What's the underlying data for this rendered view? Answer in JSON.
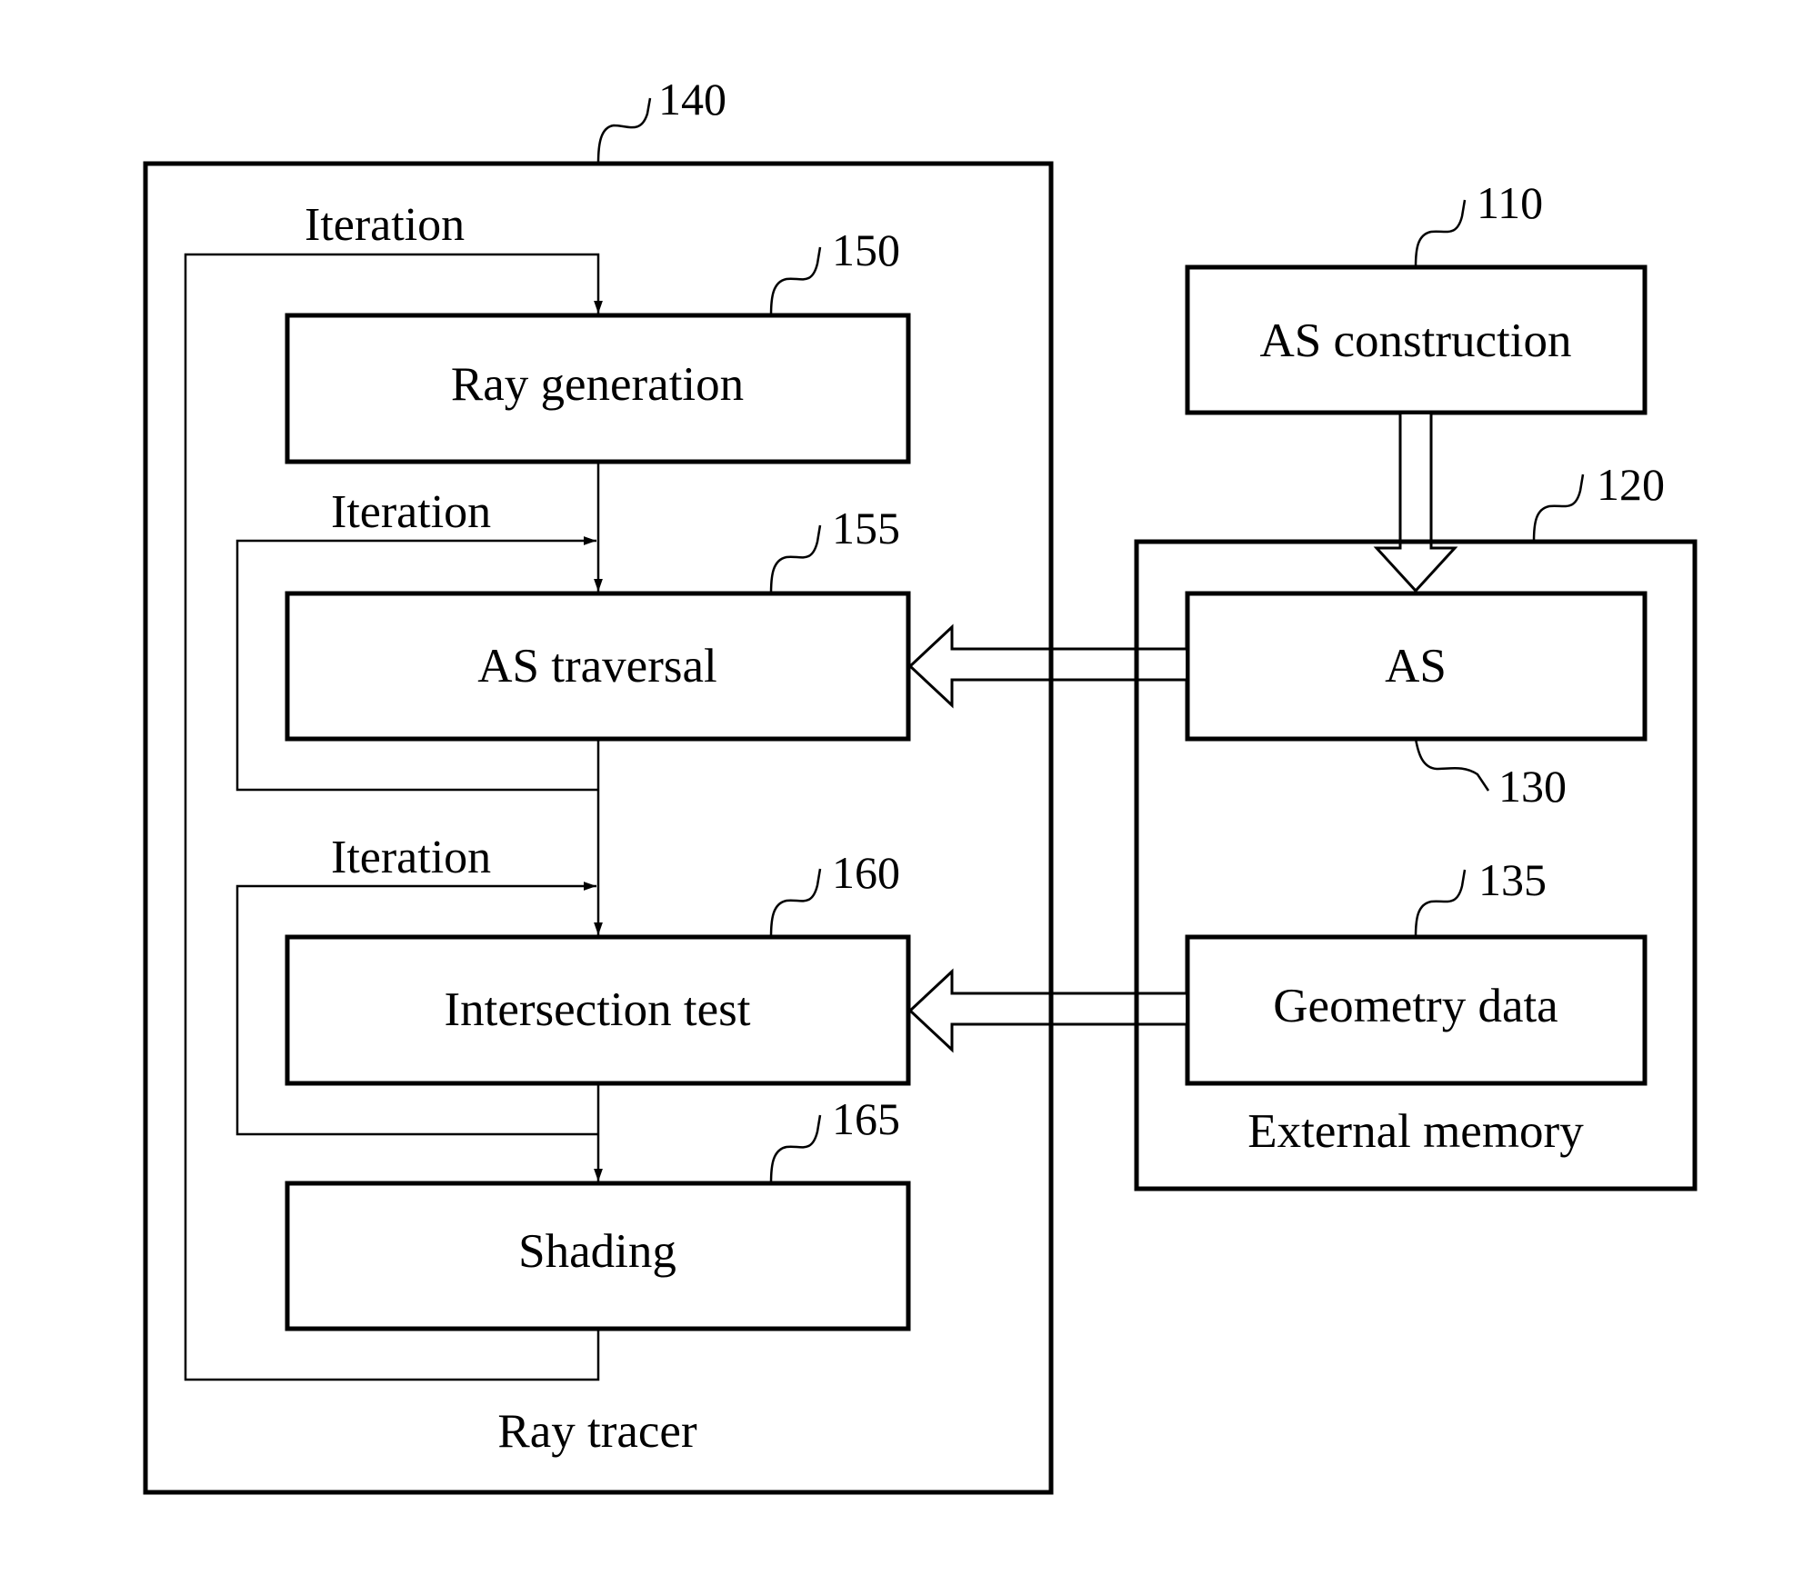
{
  "figure": {
    "ray_tracer": {
      "ref": "140",
      "caption": "Ray tracer",
      "blocks": [
        {
          "id": "ray-generation",
          "ref": "150",
          "label": "Ray generation"
        },
        {
          "id": "as-traversal",
          "ref": "155",
          "label": "AS traversal"
        },
        {
          "id": "intersection-test",
          "ref": "160",
          "label": "Intersection test"
        },
        {
          "id": "shading",
          "ref": "165",
          "label": "Shading"
        }
      ],
      "loops": [
        {
          "label": "Iteration",
          "from": "shading",
          "to": "ray-generation"
        },
        {
          "label": "Iteration",
          "from": "as-traversal",
          "to": "as-traversal"
        },
        {
          "label": "Iteration",
          "from": "intersection-test",
          "to": "intersection-test"
        }
      ]
    },
    "as_construction": {
      "ref": "110",
      "label": "AS construction"
    },
    "external_memory": {
      "ref": "120",
      "caption": "External memory",
      "blocks": [
        {
          "id": "as",
          "ref": "130",
          "label": "AS"
        },
        {
          "id": "geometry-data",
          "ref": "135",
          "label": "Geometry data"
        }
      ]
    },
    "connections": [
      {
        "from": "as-construction",
        "to": "as",
        "style": "hollow-arrow"
      },
      {
        "from": "as",
        "to": "as-traversal",
        "style": "hollow-arrow"
      },
      {
        "from": "geometry-data",
        "to": "intersection-test",
        "style": "hollow-arrow"
      },
      {
        "from": "ray-generation",
        "to": "as-traversal",
        "style": "line-arrow"
      },
      {
        "from": "as-traversal",
        "to": "intersection-test",
        "style": "line-arrow"
      },
      {
        "from": "intersection-test",
        "to": "shading",
        "style": "line-arrow"
      }
    ]
  }
}
